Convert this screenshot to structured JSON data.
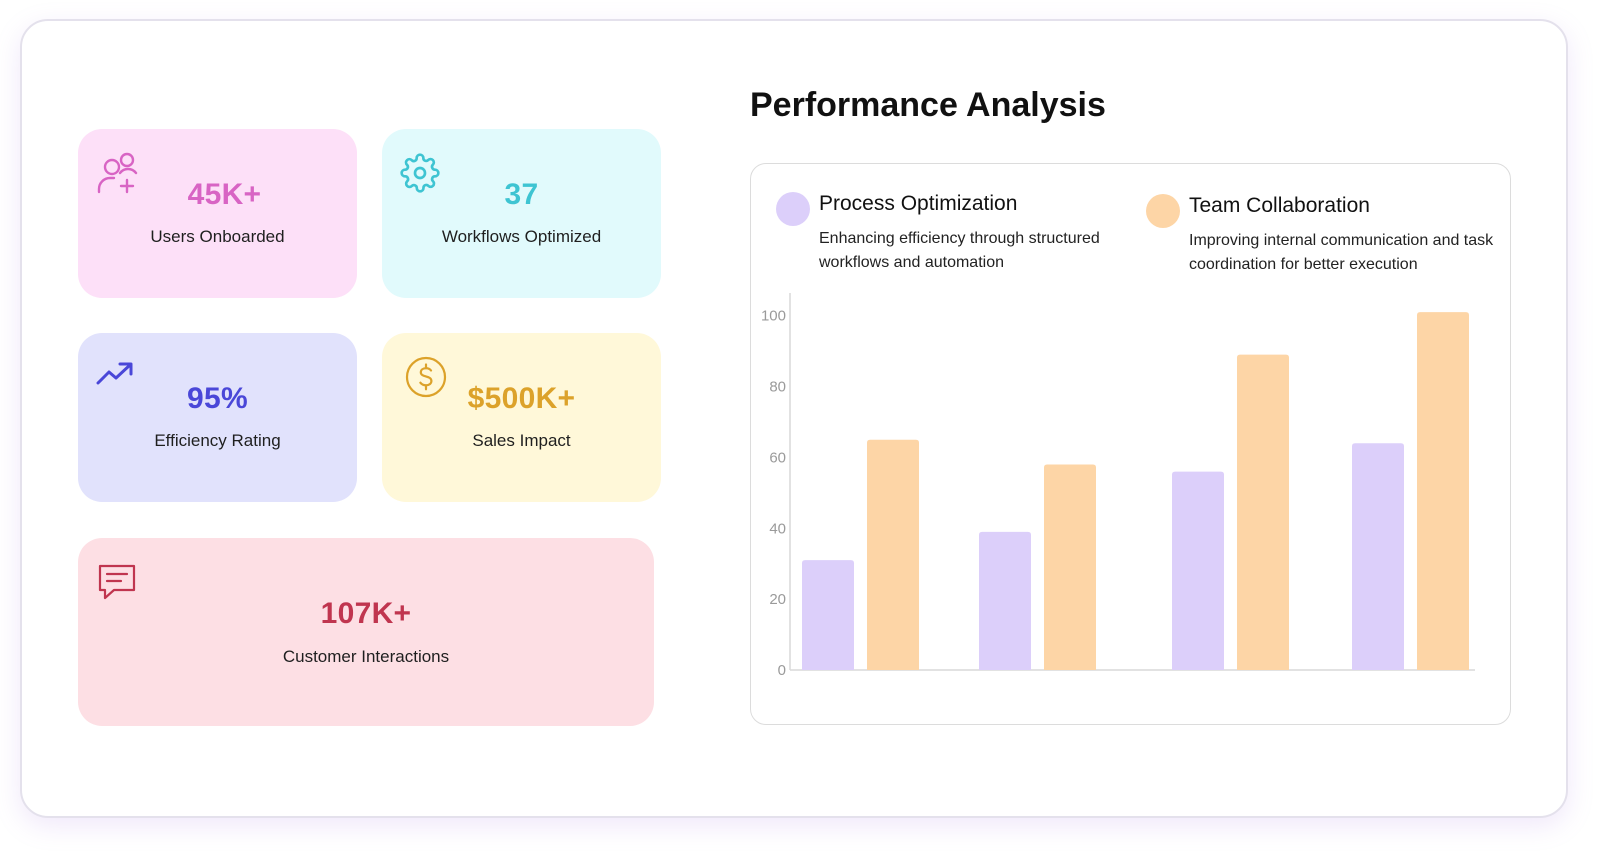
{
  "colors": {
    "users": "#d864c4",
    "workflows": "#3ec4d2",
    "efficiency": "#4a47d8",
    "sales": "#dca22a",
    "interactions": "#c0354f",
    "process": "#dccffa",
    "team": "#fdd5a6"
  },
  "stats": {
    "users": {
      "value": "45K+",
      "label": "Users Onboarded",
      "icon": "user-add-icon"
    },
    "workflows": {
      "value": "37",
      "label": "Workflows Optimized",
      "icon": "gear-icon"
    },
    "efficiency": {
      "value": "95%",
      "label": "Efficiency Rating",
      "icon": "trending-up-icon"
    },
    "sales": {
      "value": "$500K+",
      "label": "Sales Impact",
      "icon": "dollar-icon"
    },
    "interactions": {
      "value": "107K+",
      "label": "Customer Interactions",
      "icon": "chat-icon"
    }
  },
  "title": "Performance Analysis",
  "legend": {
    "process": {
      "name": "Process Optimization",
      "desc": "Enhancing efficiency through structured workflows and automation"
    },
    "team": {
      "name": "Team Collaboration",
      "desc": "Improving internal communication and task coordination for better execution"
    }
  },
  "chart_data": {
    "type": "bar",
    "categories": [
      "",
      "",
      "",
      ""
    ],
    "series": [
      {
        "name": "Process Optimization",
        "values": [
          31,
          39,
          56,
          64
        ]
      },
      {
        "name": "Team Collaboration",
        "values": [
          65,
          58,
          89,
          101
        ]
      }
    ],
    "yticks": [
      0,
      20,
      40,
      60,
      80,
      100
    ],
    "ylim": [
      0,
      105
    ],
    "grid": false
  }
}
